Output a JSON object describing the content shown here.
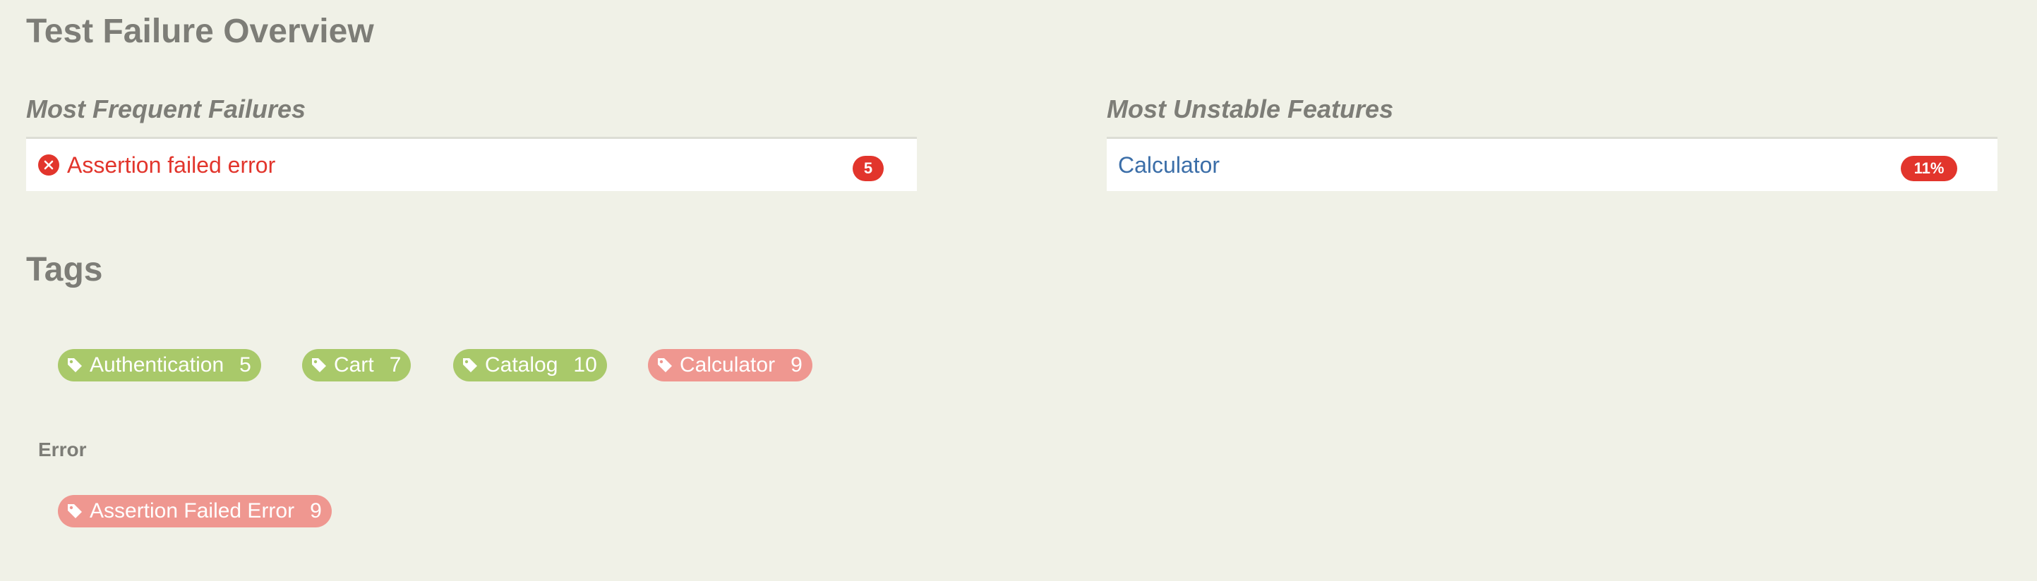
{
  "page": {
    "title": "Test Failure Overview"
  },
  "frequent_failures": {
    "heading": "Most Frequent Failures",
    "items": [
      {
        "label": "Assertion failed error",
        "count": "5",
        "icon": "error-circle-icon"
      }
    ]
  },
  "unstable_features": {
    "heading": "Most Unstable Features",
    "items": [
      {
        "label": "Calculator",
        "rate": "11%"
      }
    ]
  },
  "tags": {
    "title": "Tags",
    "items": [
      {
        "label": "Authentication",
        "count": "5",
        "status": "passing",
        "icon": "tag-icon"
      },
      {
        "label": "Cart",
        "count": "7",
        "status": "passing",
        "icon": "tag-icon"
      },
      {
        "label": "Catalog",
        "count": "10",
        "status": "passing",
        "icon": "tag-icon"
      },
      {
        "label": "Calculator",
        "count": "9",
        "status": "failing",
        "icon": "tag-icon"
      }
    ],
    "groups": [
      {
        "label": "Error",
        "items": [
          {
            "label": "Assertion Failed Error",
            "count": "9",
            "status": "failing",
            "icon": "tag-icon"
          }
        ]
      }
    ]
  },
  "colors": {
    "background": "#f0f1e7",
    "heading": "#7d7d77",
    "failure_red": "#e2352c",
    "link_blue": "#3b6ea8",
    "tag_passing": "#a9c96a",
    "tag_failing": "#ef9790"
  }
}
